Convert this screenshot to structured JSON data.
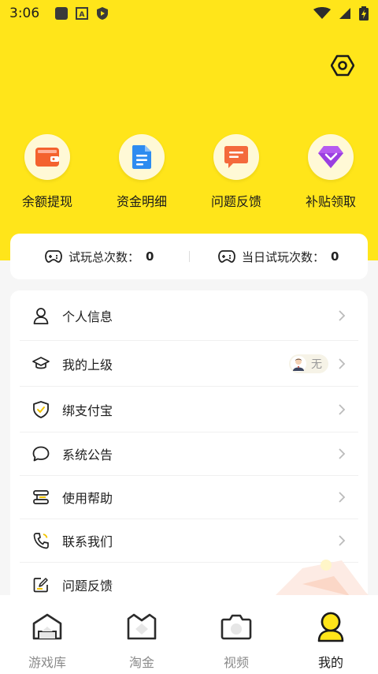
{
  "status_bar": {
    "time": "3:06"
  },
  "quick_actions": [
    {
      "label": "余额提现",
      "icon": "wallet-icon"
    },
    {
      "label": "资金明细",
      "icon": "document-icon"
    },
    {
      "label": "问题反馈",
      "icon": "chat-icon"
    },
    {
      "label": "补贴领取",
      "icon": "diamond-icon"
    }
  ],
  "stats": {
    "total_label": "试玩总次数：",
    "total_value": "0",
    "today_label": "当日试玩次数：",
    "today_value": "0"
  },
  "menu": [
    {
      "label": "个人信息",
      "icon": "user-icon"
    },
    {
      "label": "我的上级",
      "icon": "graduation-cap-icon",
      "badge": "无"
    },
    {
      "label": "绑支付宝",
      "icon": "shield-icon"
    },
    {
      "label": "系统公告",
      "icon": "speech-bubble-icon"
    },
    {
      "label": "使用帮助",
      "icon": "help-icon"
    },
    {
      "label": "联系我们",
      "icon": "phone-icon"
    },
    {
      "label": "问题反馈",
      "icon": "feedback-icon"
    }
  ],
  "bottom_nav": [
    {
      "label": "游戏库",
      "icon": "house-icon",
      "active": false
    },
    {
      "label": "淘金",
      "icon": "gold-icon",
      "active": false
    },
    {
      "label": "视频",
      "icon": "camera-icon",
      "active": false
    },
    {
      "label": "我的",
      "icon": "person-icon",
      "active": true
    }
  ],
  "colors": {
    "accent": "#ffe51a",
    "text": "#1e1e1e",
    "muted": "#8b8b8b"
  }
}
